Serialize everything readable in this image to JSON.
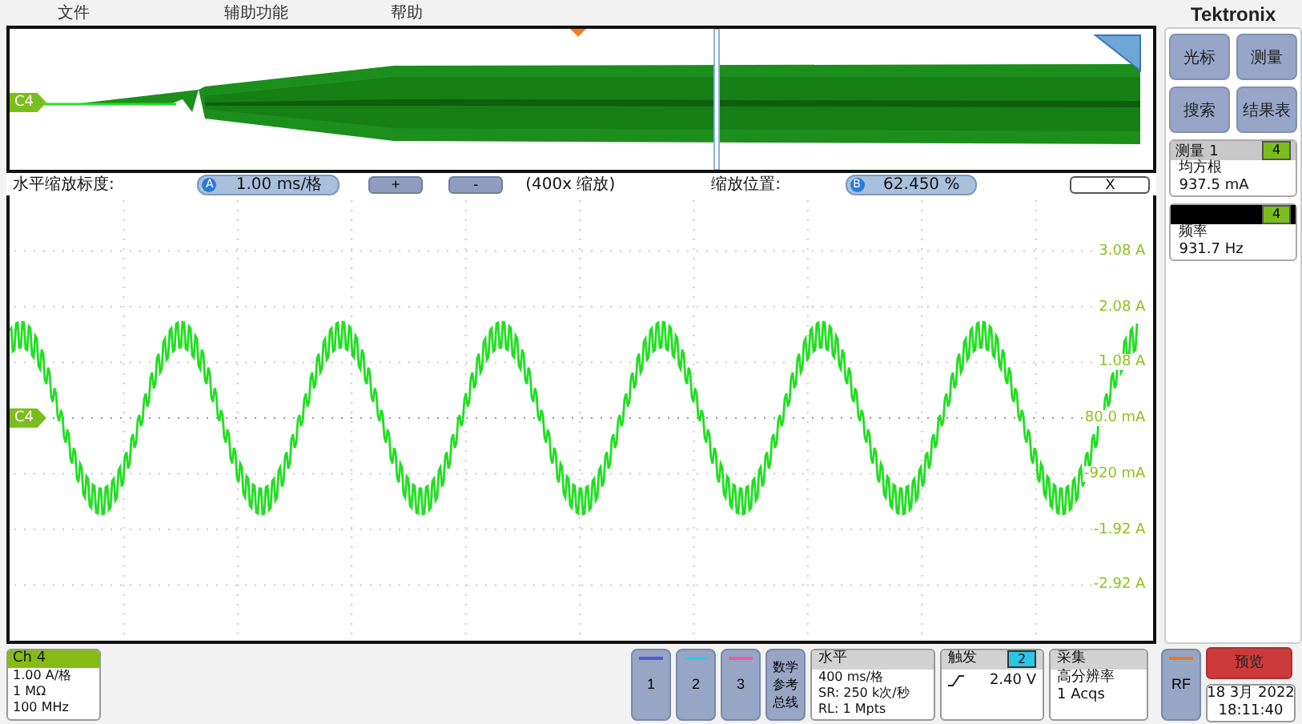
{
  "menu": [
    {
      "label": "文件"
    },
    {
      "label": "辅助功能"
    },
    {
      "label": "帮助"
    }
  ],
  "brand": "Tektronix",
  "overview": {
    "channel_marker": "C4"
  },
  "zoom_bar": {
    "scale_label": "水平缩放标度:",
    "scale_badge": "A",
    "scale_value": "1.00 ms/格",
    "zoom_in": "+",
    "zoom_out": "-",
    "zoom_factor": "(400x 缩放)",
    "position_label": "缩放位置:",
    "position_badge": "B",
    "position_value": "62.450 %",
    "close": "X"
  },
  "plot": {
    "channel_marker": "C4",
    "axis_labels": [
      "3.08 A",
      "2.08 A",
      "1.08 A",
      "80.0 mA",
      "-920 mA",
      "-1.92 A",
      "-2.92 A"
    ]
  },
  "side_buttons": [
    {
      "label": "光标"
    },
    {
      "label": "测量"
    },
    {
      "label": "搜索"
    },
    {
      "label": "结果表"
    }
  ],
  "measurements": [
    {
      "title": "测量 1",
      "channel": "4",
      "name": "均方根",
      "value": "937.5 mA",
      "selected": false
    },
    {
      "channel": "4",
      "name": "频率",
      "value": "931.7 Hz",
      "selected": true
    }
  ],
  "channel_card": {
    "title": "Ch 4",
    "lines": [
      "1.00 A/格",
      "1 MΩ",
      "100 MHz"
    ]
  },
  "channel_buttons": [
    {
      "label": "1",
      "color": "#4a5ed6"
    },
    {
      "label": "2",
      "color": "#3cc6e0"
    },
    {
      "label": "3",
      "color": "#e0609c"
    }
  ],
  "math_button": [
    "数学",
    "参考",
    "总线"
  ],
  "horizontal": {
    "title": "水平",
    "lines": [
      "400 ms/格",
      "SR: 250 k次/秒",
      "RL: 1 Mpts"
    ]
  },
  "trigger": {
    "title": "触发",
    "source": "2",
    "level": "2.40 V"
  },
  "acquisition": {
    "title": "采集",
    "lines": [
      "高分辨率",
      "1 Acqs"
    ]
  },
  "rf_button": {
    "label": "RF"
  },
  "run_button": {
    "label": "预览"
  },
  "clock": {
    "date": "18 3月 2022",
    "time": "18:11:40"
  }
}
